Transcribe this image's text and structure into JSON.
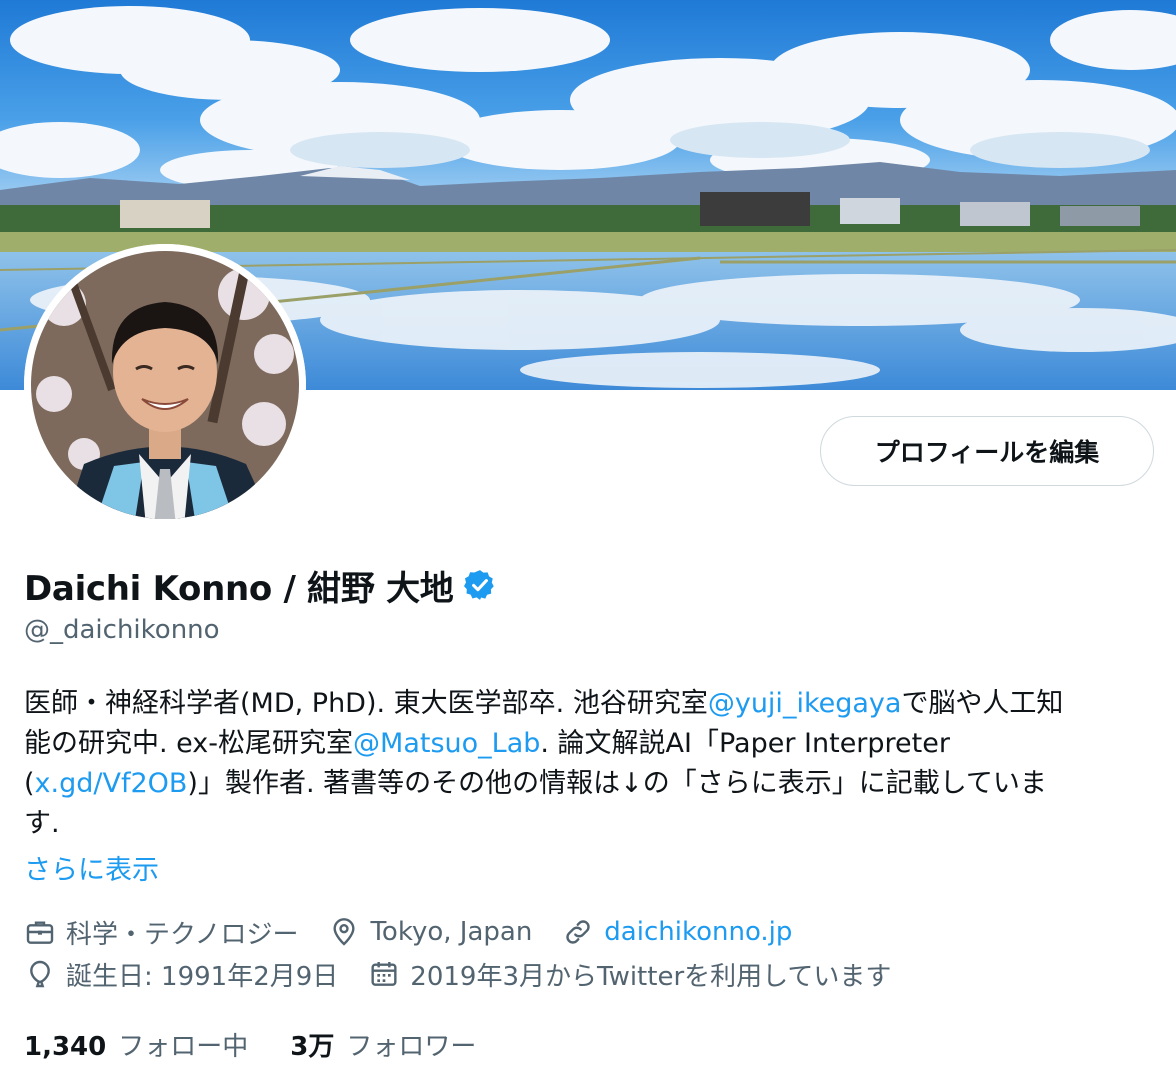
{
  "profile": {
    "edit_button": "プロフィールを編集",
    "name": "Daichi Konno / 紺野 大地",
    "handle": "@_daichikonno",
    "verified": true,
    "bio": {
      "l1_a": "医師・神経科学者(MD, PhD). 東大医学部卒. 池谷研究室",
      "l1_link": "@yuji_ikegaya",
      "l1_b": "で脳や人工知",
      "l2_a": "能の研究中. ex-松尾研究室",
      "l2_link": "@Matsuo_Lab",
      "l2_b": ". 論文解説AI「Paper Interpreter",
      "l3_a": "(",
      "l3_link": "x.gd/Vf2OB",
      "l3_b": ")」製作者. 著書等のその他の情報は↓の「さらに表示」に記載していま",
      "l4": "す."
    },
    "more_link": "さらに表示",
    "meta": {
      "category": "科学・テクノロジー",
      "location": "Tokyo, Japan",
      "website": "daichikonno.jp",
      "birthday": "誕生日: 1991年2月9日",
      "joined": "2019年3月からTwitterを利用しています"
    },
    "following_count": "1,340",
    "following_label": "フォロー中",
    "followers_count": "3万",
    "followers_label": "フォロワー"
  },
  "colors": {
    "accent": "#1d9bf0",
    "text": "#0f1419",
    "secondary": "#536471",
    "border": "#cfd9de"
  },
  "icons": [
    "verified-badge-icon",
    "briefcase-icon",
    "location-pin-icon",
    "link-icon",
    "balloon-icon",
    "calendar-icon"
  ]
}
